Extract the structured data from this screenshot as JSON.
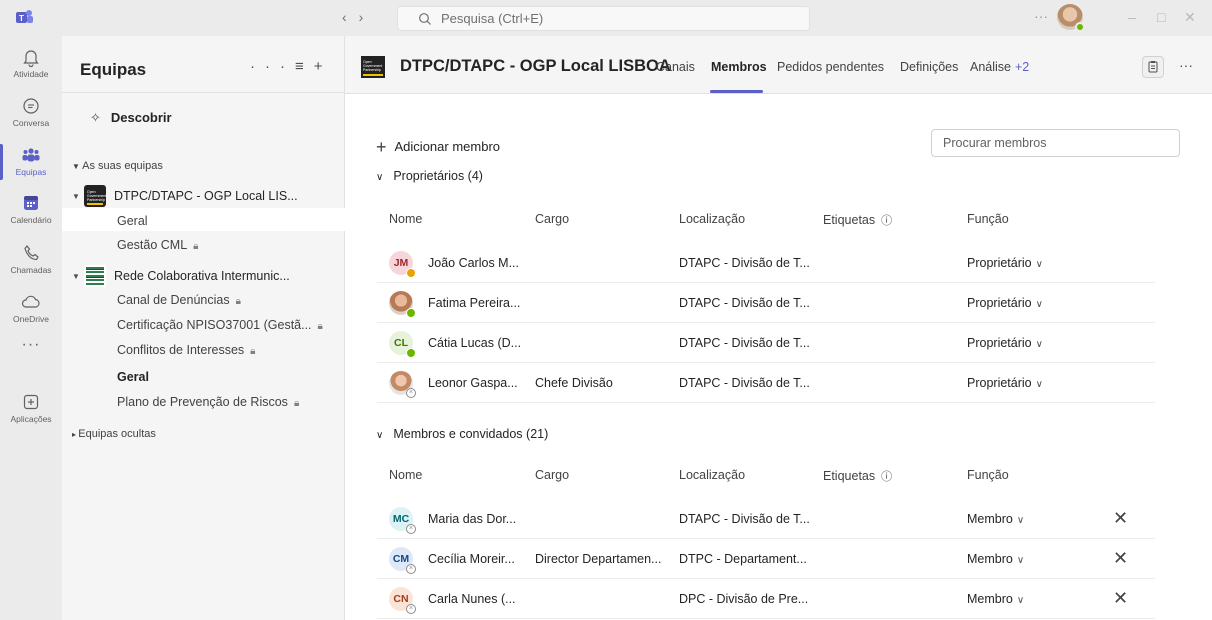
{
  "titlebar": {
    "search_placeholder": "Pesquisa (Ctrl+E)"
  },
  "rail": [
    {
      "label": "Atividade",
      "icon": "bell-icon"
    },
    {
      "label": "Conversa",
      "icon": "chat-icon"
    },
    {
      "label": "Equipas",
      "icon": "teams-icon",
      "active": true
    },
    {
      "label": "Calendário",
      "icon": "calendar-icon"
    },
    {
      "label": "Chamadas",
      "icon": "phone-icon"
    },
    {
      "label": "OneDrive",
      "icon": "cloud-icon"
    },
    {
      "label": "Aplicações",
      "icon": "add-app-icon"
    }
  ],
  "teams_panel": {
    "title": "Equipas",
    "discover": "Descobrir",
    "your_teams_label": "As suas equipas",
    "hidden_teams_label": "Equipas ocultas",
    "teams": [
      {
        "name": "DTPC/DTAPC - OGP Local LIS...",
        "channels": [
          {
            "name": "Geral",
            "selected": true
          },
          {
            "name": "Gestão CML",
            "locked": true
          }
        ]
      },
      {
        "name": "Rede Colaborativa Intermunic...",
        "channels": [
          {
            "name": "Canal de Denúncias",
            "locked": true
          },
          {
            "name": "Certificação NPISO37001 (Gestã...",
            "locked": true
          },
          {
            "name": "Conflitos de Interesses",
            "locked": true
          },
          {
            "name": "Geral",
            "bold": true
          },
          {
            "name": "Plano de Prevenção de Riscos",
            "locked": true
          }
        ]
      }
    ]
  },
  "main": {
    "channel_title": "DTPC/DTAPC - OGP Local LISBOA",
    "tabs": [
      "Canais",
      "Membros",
      "Pedidos pendentes",
      "Definições",
      "Análise"
    ],
    "tabs_more": "+2",
    "active_tab": "Membros",
    "add_member": "Adicionar membro",
    "search_members_placeholder": "Procurar membros",
    "columns": {
      "name": "Nome",
      "cargo": "Cargo",
      "location": "Localização",
      "tags": "Etiquetas",
      "role": "Função"
    },
    "owners_section": "Proprietários (4)",
    "members_section": "Membros e convidados (21)",
    "owners": [
      {
        "initials": "JM",
        "name": "João Carlos M...",
        "cargo": "",
        "location": "DTAPC - Divisão de T...",
        "role": "Proprietário",
        "presence": "away",
        "avatar_bg": "#f6d6d9",
        "avatar_fg": "#a4262c"
      },
      {
        "initials": "",
        "name": "Fatima Pereira...",
        "cargo": "",
        "location": "DTAPC - Divisão de T...",
        "role": "Proprietário",
        "presence": "available",
        "photo": true
      },
      {
        "initials": "CL",
        "name": "Cátia Lucas (D...",
        "cargo": "",
        "location": "DTAPC - Divisão de T...",
        "role": "Proprietário",
        "presence": "available",
        "avatar_bg": "#e7f2da",
        "avatar_fg": "#437406"
      },
      {
        "initials": "",
        "name": "Leonor Gaspa...",
        "cargo": "Chefe Divisão",
        "location": "DTAPC - Divisão de T...",
        "role": "Proprietário",
        "presence": "offline",
        "photo": true
      }
    ],
    "members": [
      {
        "initials": "MC",
        "name": "Maria das Dor...",
        "cargo": "",
        "location": "DTAPC - Divisão de T...",
        "role": "Membro",
        "presence": "offline",
        "avatar_bg": "#dcf2f4",
        "avatar_fg": "#00666d"
      },
      {
        "initials": "CM",
        "name": "Cecília Moreir...",
        "cargo": "Director Departamen...",
        "location": "DTPC - Departament...",
        "role": "Membro",
        "presence": "offline",
        "avatar_bg": "#dfe8f7",
        "avatar_fg": "#0f4a8a"
      },
      {
        "initials": "CN",
        "name": "Carla Nunes (...",
        "cargo": "",
        "location": "DPC - Divisão de Pre...",
        "role": "Membro",
        "presence": "offline",
        "avatar_bg": "#fbe3d8",
        "avatar_fg": "#a33c17"
      }
    ]
  },
  "colors": {
    "brand": "#5b5fc7",
    "available": "#6bb700",
    "away": "#eaa300"
  }
}
